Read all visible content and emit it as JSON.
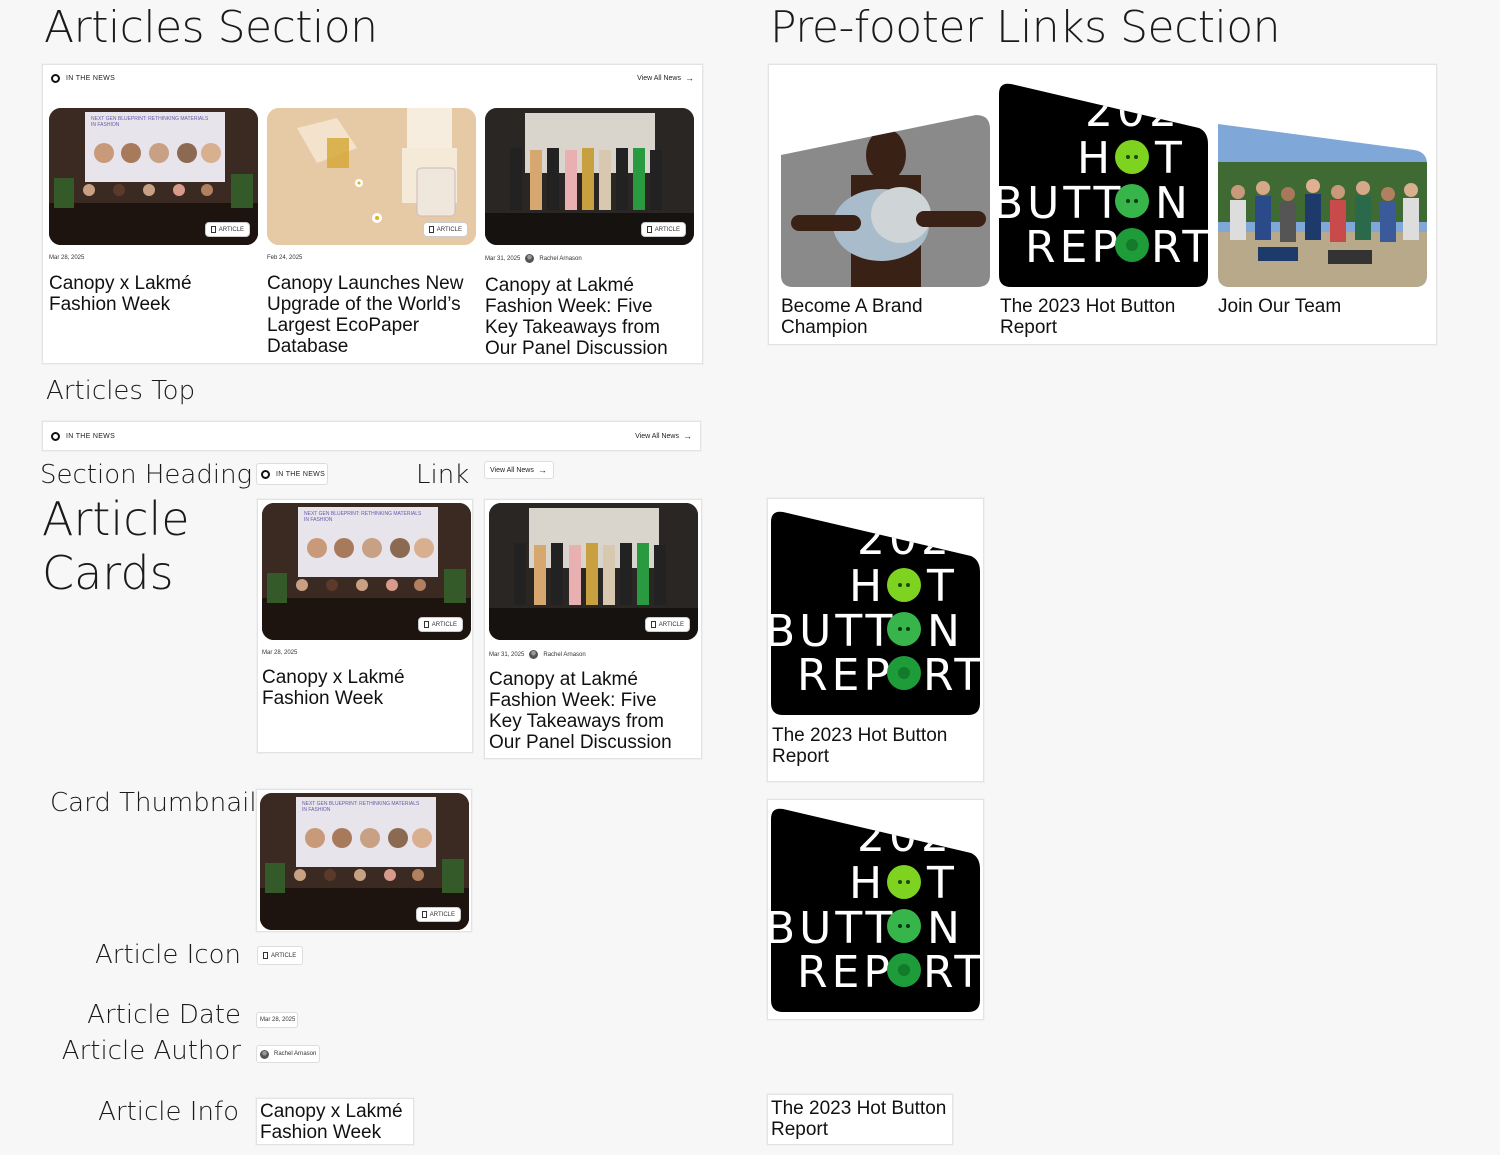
{
  "headings": {
    "articles_section": "Articles Section",
    "prefooter_section": "Pre-footer Links Section"
  },
  "labels": {
    "articles_top": "Articles Top",
    "section_heading": "Section Heading",
    "link": "Link",
    "article_cards_1": "Article",
    "article_cards_2": "Cards",
    "card_thumbnail": "Card Thumbnail",
    "article_icon": "Article Icon",
    "article_date": "Article Date",
    "article_author": "Article Author",
    "article_info": "Article Info"
  },
  "news": {
    "tag": "IN THE NEWS",
    "view_all": "View All News",
    "badge": "ARTICLE"
  },
  "articles": [
    {
      "date": "Mar 28, 2025",
      "author": "",
      "title": "Canopy x Lakmé Fashion Week",
      "slide_text": "NEXT GEN BLUEPRINT: RETHINKING MATERIALS IN FASHION"
    },
    {
      "date": "Feb 24, 2025",
      "author": "",
      "title": "Canopy Launches New Upgrade of the World’s Largest EcoPaper Database"
    },
    {
      "date": "Mar 31, 2025",
      "author": "Rachel Arnason",
      "title": "Canopy at Lakmé Fashion Week: Five Key Takeaways from Our Panel Discussion"
    }
  ],
  "prefooter_links": [
    {
      "title": "Become A Brand Champion"
    },
    {
      "title": "The 2023 Hot Button Report"
    },
    {
      "title": "Join Our Team"
    }
  ],
  "hot_button": {
    "line1": "202",
    "line2a": "H",
    "line2b": "T",
    "line3a": "BUTT",
    "line3b": "N",
    "line4a": "REP",
    "line4b": "RT"
  },
  "colors": {
    "background": "#f7f7f7",
    "card": "#ffffff",
    "hot_black": "#000000",
    "hot_green": "#7ed321",
    "hot_green_dark": "#1f9c3a"
  }
}
